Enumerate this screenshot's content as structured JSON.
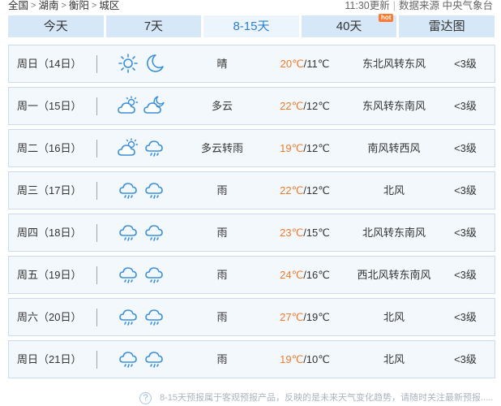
{
  "breadcrumb": {
    "items": [
      "全国",
      "湖南",
      "衡阳",
      "城区"
    ],
    "separator": ">"
  },
  "header": {
    "updated": "11:30更新",
    "source": "数据来源 中央气象台"
  },
  "tabs": [
    {
      "label": "今天",
      "active": false,
      "badge": ""
    },
    {
      "label": "7天",
      "active": false,
      "badge": ""
    },
    {
      "label": "8-15天",
      "active": true,
      "badge": ""
    },
    {
      "label": "40天",
      "active": false,
      "badge": "hot"
    },
    {
      "label": "雷达图",
      "active": false,
      "badge": ""
    }
  ],
  "forecast": [
    {
      "day": "周日（14日）",
      "icon_day": "sunny-icon",
      "icon_night": "moon-icon",
      "condition": "晴",
      "high": "20℃",
      "low": "/11℃",
      "wind": "东北风转东风",
      "level": "<3级"
    },
    {
      "day": "周一（15日）",
      "icon_day": "partly-cloudy-icon",
      "icon_night": "cloudy-night-icon",
      "condition": "多云",
      "high": "22℃",
      "low": "/12℃",
      "wind": "东风转东南风",
      "level": "<3级"
    },
    {
      "day": "周二（16日）",
      "icon_day": "partly-cloudy-icon",
      "icon_night": "rain-icon",
      "condition": "多云转雨",
      "high": "19℃",
      "low": "/12℃",
      "wind": "南风转西风",
      "level": "<3级"
    },
    {
      "day": "周三（17日）",
      "icon_day": "rain-icon",
      "icon_night": "rain-icon",
      "condition": "雨",
      "high": "22℃",
      "low": "/12℃",
      "wind": "北风",
      "level": "<3级"
    },
    {
      "day": "周四（18日）",
      "icon_day": "rain-icon",
      "icon_night": "rain-icon",
      "condition": "雨",
      "high": "23℃",
      "low": "/15℃",
      "wind": "北风转东南风",
      "level": "<3级"
    },
    {
      "day": "周五（19日）",
      "icon_day": "rain-icon",
      "icon_night": "rain-icon",
      "condition": "雨",
      "high": "24℃",
      "low": "/16℃",
      "wind": "西北风转东南风",
      "level": "<3级"
    },
    {
      "day": "周六（20日）",
      "icon_day": "rain-icon",
      "icon_night": "rain-icon",
      "condition": "雨",
      "high": "27℃",
      "low": "/19℃",
      "wind": "北风",
      "level": "<3级"
    },
    {
      "day": "周日（21日）",
      "icon_day": "rain-icon",
      "icon_night": "rain-icon",
      "condition": "雨",
      "high": "19℃",
      "low": "/10℃",
      "wind": "北风",
      "level": "<3级"
    }
  ],
  "footer": {
    "note": "8-15天预报属于客观预报产品，反映的是未来天气变化趋势，请随时关注最新预报....."
  },
  "colors": {
    "accent": "#2a7fd1",
    "tab_bg": "#d6e8f7",
    "high_temp": "#f07a2a",
    "icon_stroke": "#3a8fd9"
  }
}
